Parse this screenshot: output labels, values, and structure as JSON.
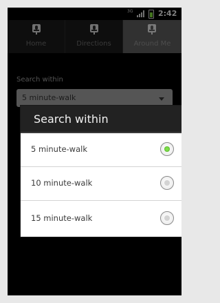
{
  "statusbar": {
    "network": "3G",
    "time": "2:42",
    "battery_color": "#7fd83b"
  },
  "tabs": [
    {
      "label": "Home",
      "icon": "microphone-icon",
      "selected": false
    },
    {
      "label": "Directions",
      "icon": "microphone-icon",
      "selected": false
    },
    {
      "label": "Around Me",
      "icon": "microphone-icon",
      "selected": true
    }
  ],
  "content": {
    "search_label": "Search within",
    "spinner_value": "5 minute-walk"
  },
  "dialog": {
    "title": "Search within",
    "options": [
      {
        "label": "5 minute-walk",
        "checked": true
      },
      {
        "label": "10 minute-walk",
        "checked": false
      },
      {
        "label": "15 minute-walk",
        "checked": false
      }
    ],
    "check_color": "#7fe04a"
  }
}
